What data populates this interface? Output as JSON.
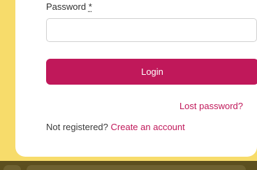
{
  "login_form": {
    "password_label": "Password",
    "required_marker": "*",
    "password_value": "",
    "password_placeholder": "",
    "login_button_label": "Login",
    "lost_password_link": "Lost password?",
    "not_registered_text": "Not registered?",
    "create_account_link": "Create an account"
  },
  "colors": {
    "accent": "#c0185a",
    "background": "#f7dc6b",
    "card": "#ffffff"
  }
}
